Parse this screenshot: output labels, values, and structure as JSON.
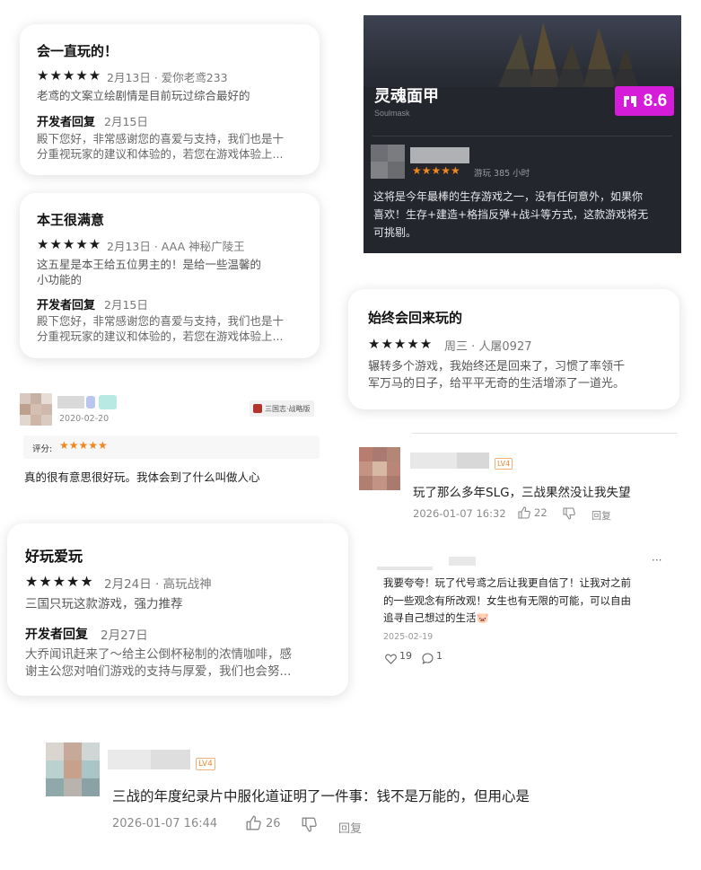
{
  "review1": {
    "title": "会一直玩的！",
    "stars": "★★★★★",
    "meta": "2月13日 · 爱你老鸢233",
    "body": "老鸢的文案立绘剧情是目前玩过综合最好的",
    "dev_label": "开发者回复",
    "dev_date": "2月15日",
    "reply_line1": "殿下您好，非常感谢您的喜爱与支持，我们也是十",
    "reply_line2": "分重视玩家的建议和体验的，若您在游戏体验上..."
  },
  "review2": {
    "title": "本王很满意",
    "stars": "★★★★★",
    "meta": "2月13日 · AAA 神秘广陵王",
    "body_line1": "这五星是本王给五位男主的！是给一些温馨的",
    "body_line2": "小功能的",
    "dev_label": "开发者回复",
    "dev_date": "2月15日",
    "reply_line1": "殿下您好，非常感谢您的喜爱与支持，我们也是十",
    "reply_line2": "分重视玩家的建议和体验的，若您在游戏体验上..."
  },
  "game_card": {
    "title": "灵魂面甲",
    "subtitle": "Soulmask",
    "score": "8.6",
    "stars": "★★★★★",
    "playtime": "游玩 385 小时",
    "body_line1": "这将是今年最棒的生存游戏之一，没有任何意外，如果你",
    "body_line2": "喜欢！生存+建造+格挡反弹+战斗等方式，这款游戏将无",
    "body_line3": "可挑剔。"
  },
  "review3": {
    "title": "始终会回来玩的",
    "stars": "★★★★★",
    "meta": "周三 · 人屠0927",
    "body_line1": "辗转多个游戏，我始终还是回来了，习惯了率领千",
    "body_line2": "军万马的日子，给平平无奇的生活增添了一道光。"
  },
  "tieba": {
    "date": "2020-02-20",
    "game_tag": "三国志·战略版",
    "score_label": "评分:",
    "stars": "★★★★★",
    "body": "真的很有意思很好玩。我体会到了什么叫做人心"
  },
  "comment1": {
    "level_tag": "LV4",
    "text": "玩了那么多年SLG，三战果然没让我失望",
    "date": "2026-01-07 16:32",
    "likes": "22",
    "reply": "回复"
  },
  "review4": {
    "title": "好玩爱玩",
    "stars": "★★★★★",
    "meta": "2月24日 · 高玩战神",
    "body": "三国只玩这款游戏，强力推荐",
    "dev_label": "开发者回复",
    "dev_date": "2月27日",
    "reply_line1": "大乔闻讯赶来了～给主公倒杯秘制的浓情咖啡，感",
    "reply_line2": "谢主公您对咱们游戏的支持与厚爱，我们也会努..."
  },
  "comment2": {
    "more": "···",
    "line1": "我要夸夸！玩了代号鸢之后让我更自信了！让我对之前",
    "line2": "的一些观念有所改观！女生也有无限的可能，可以自由",
    "line3": "追寻自己想过的生活🐷",
    "date": "2025-02-19",
    "likes": "19",
    "comments": "1"
  },
  "comment3": {
    "level_tag": "LV4",
    "text": "三战的年度纪录片中服化道证明了一件事：钱不是万能的，但用心是",
    "date": "2026-01-07 16:44",
    "likes": "26",
    "reply": "回复"
  },
  "colors": {
    "score_badge": "#d41cd9",
    "star_orange": "#f0861e",
    "tag_orange": "#f08a30"
  }
}
